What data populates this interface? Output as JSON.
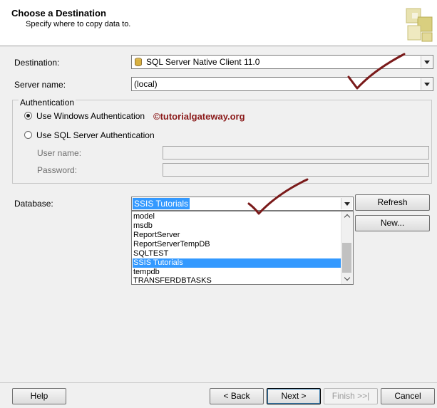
{
  "header": {
    "title": "Choose a Destination",
    "subtitle": "Specify where to copy data to."
  },
  "destination": {
    "label": "Destination:",
    "value": "SQL Server Native Client 11.0"
  },
  "server": {
    "label": "Server name:",
    "value": "(local)"
  },
  "authentication": {
    "group_label": "Authentication",
    "windows_option": "Use Windows Authentication",
    "sql_option": "Use SQL Server Authentication",
    "selected": "windows",
    "username_label": "User name:",
    "password_label": "Password:"
  },
  "watermark": "©tutorialgateway.org",
  "database": {
    "label": "Database:",
    "value": "SSIS Tutorials",
    "refresh_label": "Refresh",
    "new_label": "New...",
    "options": [
      "model",
      "msdb",
      "ReportServer",
      "ReportServerTempDB",
      "SQLTEST",
      "SSIS Tutorials",
      "tempdb",
      "TRANSFERDBTASKS"
    ],
    "selected_index": 5
  },
  "footer": {
    "help": "Help",
    "back": "< Back",
    "next": "Next >",
    "finish": "Finish >>|",
    "cancel": "Cancel"
  },
  "colors": {
    "selection": "#3399ff",
    "checkmark": "#7a1a1a",
    "watermark": "#8b1a1a"
  }
}
